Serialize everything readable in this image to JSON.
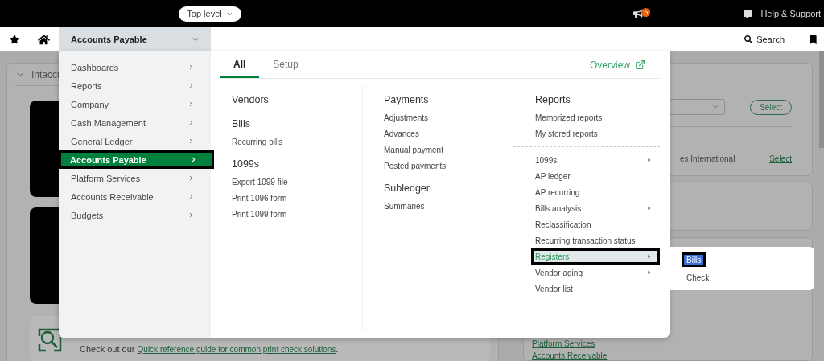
{
  "top_bar": {
    "level_picker": "Top level",
    "notification_badge": "5",
    "help": "Help & Support"
  },
  "nav_bar": {
    "module": "Accounts Payable",
    "search": "Search"
  },
  "background": {
    "left_panel": {
      "title": "Intacct",
      "info": {
        "before": "Check out our ",
        "link": "Quick reference guide for common print check solutions",
        "after": "."
      }
    },
    "right_panel": {
      "select_button": "Select",
      "entity": "es International",
      "select_link": "Select",
      "links": [
        "Platform Services",
        "Accounts Receivable"
      ]
    }
  },
  "menu": {
    "modules": [
      {
        "label": "Dashboards",
        "selected": false
      },
      {
        "label": "Reports",
        "selected": false
      },
      {
        "label": "Company",
        "selected": false
      },
      {
        "label": "Cash Management",
        "selected": false
      },
      {
        "label": "General Ledger",
        "selected": false
      },
      {
        "label": "Accounts Payable",
        "selected": true
      },
      {
        "label": "Platform Services",
        "selected": false
      },
      {
        "label": "Accounts Receivable",
        "selected": false
      },
      {
        "label": "Budgets",
        "selected": false
      }
    ],
    "tabs": [
      {
        "label": "All",
        "selected": true
      },
      {
        "label": "Setup",
        "selected": false
      }
    ],
    "overview": "Overview",
    "columns": [
      {
        "sections": [
          {
            "heading": "Vendors"
          },
          {
            "heading": "Bills",
            "items": [
              "Recurring bills"
            ]
          },
          {
            "heading": "1099s",
            "items": [
              "Export 1099 file",
              "Print 1096 form",
              "Print 1099 form"
            ]
          }
        ]
      },
      {
        "sections": [
          {
            "heading": "Payments",
            "items": [
              "Adjustments",
              "Advances",
              "Manual payment",
              "Posted payments"
            ]
          },
          {
            "heading": "Subledger",
            "items": [
              "Summaries"
            ]
          }
        ]
      }
    ],
    "reports": {
      "heading": "Reports",
      "groups": [
        [
          {
            "label": "Memorized reports",
            "submenu": false,
            "selected": false
          },
          {
            "label": "My stored reports",
            "submenu": false,
            "selected": false
          }
        ],
        [
          {
            "label": "1099s",
            "submenu": true,
            "selected": false
          },
          {
            "label": "AP ledger",
            "submenu": false,
            "selected": false
          },
          {
            "label": "AP recurring",
            "submenu": false,
            "selected": false
          },
          {
            "label": "Bills analysis",
            "submenu": true,
            "selected": false
          },
          {
            "label": "Reclassification",
            "submenu": false,
            "selected": false
          },
          {
            "label": "Recurring transaction status",
            "submenu": false,
            "selected": false
          },
          {
            "label": "Registers",
            "submenu": true,
            "selected": true
          },
          {
            "label": "Vendor aging",
            "submenu": true,
            "selected": false
          },
          {
            "label": "Vendor list",
            "submenu": false,
            "selected": false
          }
        ]
      ]
    },
    "flyout": [
      {
        "label": "Bills",
        "selected": true
      },
      {
        "label": "Check",
        "selected": false
      }
    ]
  }
}
